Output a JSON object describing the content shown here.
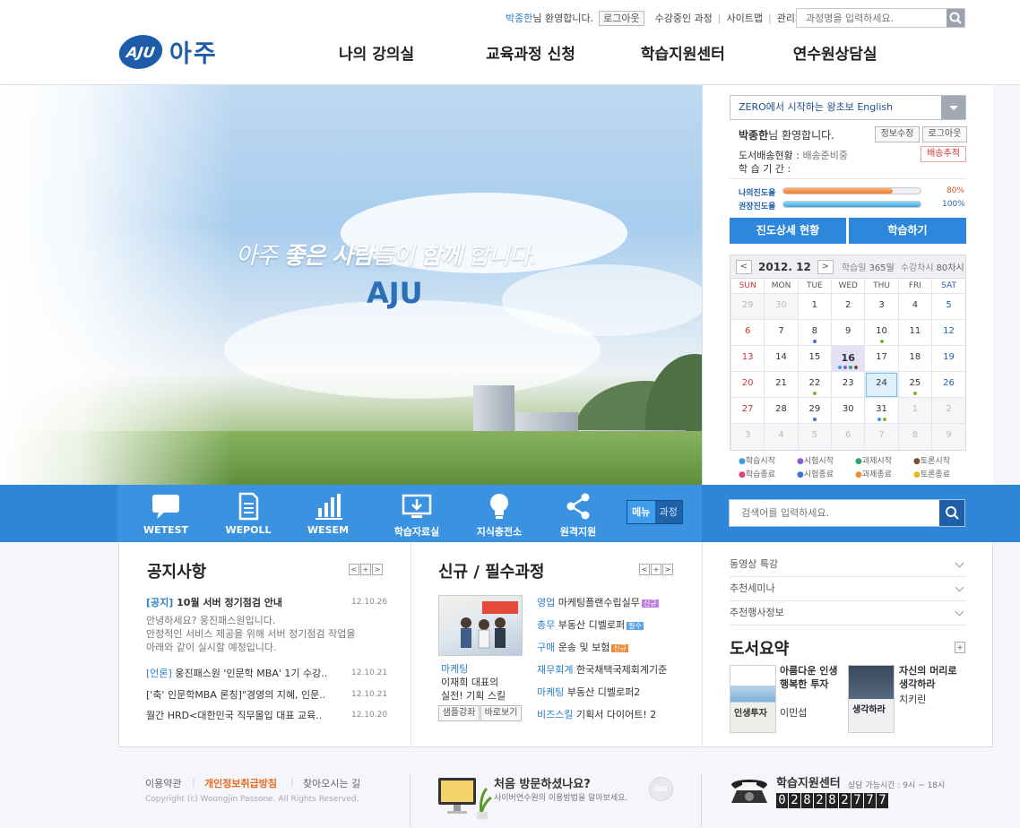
{
  "header": {
    "user_name": "박종한",
    "welcome_suffix": "님 환영합니다.",
    "logout": "로그아웃",
    "util_links": [
      "수강중인 과정",
      "사이트맵",
      "관리자"
    ],
    "search_placeholder": "과정명을 입력하세요.",
    "logo_mark": "AJU",
    "logo_name": "아주",
    "nav": [
      "나의 강의실",
      "교육과정 신청",
      "학습지원센터",
      "연수원상담실"
    ]
  },
  "hero": {
    "slogan_1": "아주 ",
    "slogan_2": "좋은 사람",
    "slogan_3": "들이 ",
    "slogan_4": "함께",
    "slogan_5": " 합니다.",
    "brand": "AJU"
  },
  "side": {
    "course_select": "ZERO에서 시작하는 왕초보 English",
    "user_name": "박종한",
    "welcome_suffix": "님 환영합니다.",
    "edit_info": "정보수정",
    "logout": "로그아웃",
    "delivery_label": "도서배송현황 :",
    "delivery_value": "배송준비중",
    "track": "배송추적",
    "period_label": "학 습 기 간 :",
    "my_progress_label": "나의진도율",
    "my_progress_value": "80%",
    "rec_progress_label": "권장진도율",
    "rec_progress_value": "100%",
    "detail_button": "진도상세 현황",
    "study_button": "학습하기"
  },
  "progress": {
    "mine": 0.8,
    "recommended": 1.0
  },
  "calendar": {
    "month": "2012. 12",
    "prev": "<",
    "next": ">",
    "info_a_label": "학습일",
    "info_a_value": "365일",
    "info_b_label": "수강차시",
    "info_b_value": "80차시",
    "weekdays": [
      "SUN",
      "MON",
      "TUE",
      "WED",
      "THU",
      "FRI",
      "SAT"
    ],
    "weeks": [
      [
        "29",
        "30",
        "1",
        "2",
        "3",
        "4",
        "5"
      ],
      [
        "6",
        "7",
        "8",
        "9",
        "10",
        "11",
        "12"
      ],
      [
        "13",
        "14",
        "15",
        "16",
        "17",
        "18",
        "19"
      ],
      [
        "20",
        "21",
        "22",
        "23",
        "24",
        "25",
        "26"
      ],
      [
        "27",
        "28",
        "29",
        "30",
        "31",
        "1",
        "2"
      ],
      [
        "3",
        "4",
        "5",
        "6",
        "7",
        "8",
        "9"
      ]
    ],
    "legend": [
      "학습시작",
      "시험시작",
      "과제시작",
      "토론시작",
      "학습종료",
      "시험종료",
      "과제종료",
      "토론종료"
    ],
    "legend_colors": [
      "#2fa1e0",
      "#8a5bd6",
      "#2aa56b",
      "#7a4b32",
      "#e0407a",
      "#4470d8",
      "#f09030",
      "#e6b820"
    ]
  },
  "quick": {
    "items": [
      "WETEST",
      "WEPOLL",
      "WESEM",
      "학습자료실",
      "지식충전소",
      "원격지원"
    ],
    "toggle_menu": "메뉴",
    "toggle_course": "과정",
    "search_placeholder": "검색어를 입력하세요."
  },
  "notice": {
    "title": "공지사항",
    "ctrl": [
      "<",
      "+",
      ">"
    ],
    "top_tag": "[공지]",
    "top_title": "10월 서버 정기점검 안내",
    "top_date": "12.10.26",
    "top_body": [
      "안녕하세요? 웅진패스원입니다.",
      "안정적인 서비스 제공을 위해 서버 정기점검 작업을",
      "아래와 같이 실시할 예정입니다."
    ],
    "items": [
      {
        "tag": "[언론]",
        "text": " 웅진패스원 '인문학 MBA' 1기 수강..",
        "date": "12.10.21"
      },
      {
        "tag": "",
        "text": "['축' 인문학MBA 론칭]\"경영의 지혜, 인문..",
        "date": "12.10.21"
      },
      {
        "tag": "",
        "text": "월간 HRD<대한민국 직무몰입 대표 교육..",
        "date": "12.10.20"
      }
    ]
  },
  "courses": {
    "title": "신규 / 필수과정",
    "ctrl": [
      "<",
      "+",
      ">"
    ],
    "feature_tag": "마케팅",
    "feature_lines": [
      "이재희 대표의",
      "실전! 기획 스킬"
    ],
    "sample": "샘플강좌",
    "go": "바로보기",
    "items": [
      {
        "cat": "영업",
        "text": "마케팅플랜수립실무",
        "badge": "신규",
        "badge_color": "#c07de0"
      },
      {
        "cat": "총무",
        "text": "부동산 디벨로퍼",
        "badge": "필수",
        "badge_color": "#5ba4e8"
      },
      {
        "cat": "구매",
        "text": "운송 및 보험",
        "badge": "신규",
        "badge_color": "#f08a3c"
      },
      {
        "cat": "재무회계",
        "text": "한국채택국제회계기준",
        "badge": "",
        "badge_color": ""
      },
      {
        "cat": "마케팅",
        "text": "부동산 디벨로퍼2",
        "badge": "",
        "badge_color": ""
      },
      {
        "cat": "비즈스킬",
        "text": "기획서 다이어트! 2",
        "badge": "",
        "badge_color": ""
      }
    ]
  },
  "right": {
    "accordion": [
      "동영상 특강",
      "추천세미나",
      "추천행사정보"
    ],
    "books_title": "도서요약",
    "books": [
      {
        "title": "아름다운 인생 행복한 투자",
        "author": "이민섭",
        "cover": "인생투자"
      },
      {
        "title": "자신의 머리로 생각하라",
        "author": "치키린",
        "cover": "생각하라"
      }
    ]
  },
  "footer": {
    "links": [
      "이용약관",
      "개인정보취급방침",
      "찾아오시는 길"
    ],
    "copyright": "Copyright (c) Woongjin Passone. All Rights Reserved.",
    "visit_title": "처음 방문하셨나요?",
    "visit_sub": "사이버연수원의 이용방법을 알아보세요.",
    "go": "GO",
    "support_title": "학습지원센터",
    "support_hours": "상담 가능시간 : 9시 ~ 18시",
    "phone": [
      "0",
      "2",
      "8",
      "2",
      "8",
      "2",
      "7",
      "7",
      "7"
    ]
  }
}
